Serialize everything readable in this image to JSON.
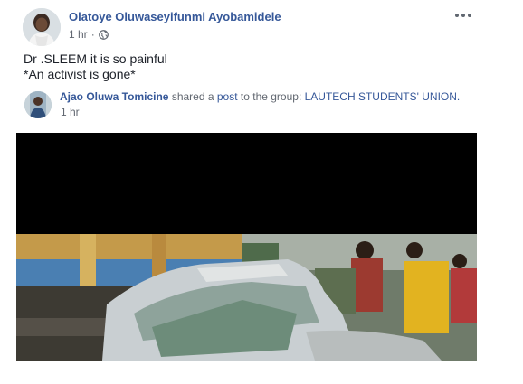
{
  "post": {
    "author": "Olatoye Oluwaseyifunmi Ayobamidele",
    "time": "1 hr",
    "privacy_icon": "globe-icon",
    "more_icon": "more-options-icon",
    "text_line1": "Dr .SLEEM it is so painful",
    "text_line2": "*An activist is gone*"
  },
  "shared": {
    "author": "Ajao Oluwa Tomicine",
    "shared_a": "shared a",
    "post_word": "post",
    "to_the_group": "to the group:",
    "group": "LAUTECH STUDENTS' UNION.",
    "time": "1 hr"
  },
  "image": {
    "description_icon": "accident-photo"
  }
}
